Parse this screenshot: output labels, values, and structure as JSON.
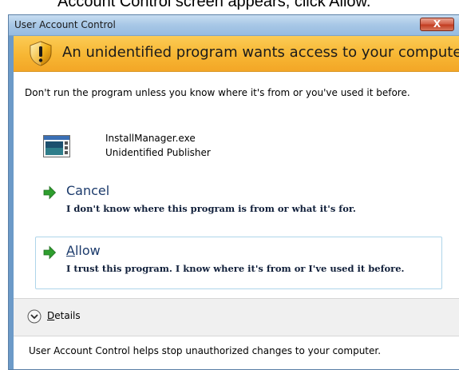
{
  "instruction": {
    "text": "Account Control screen appears, click Allow."
  },
  "window": {
    "title": "User Account Control",
    "close_label": "X"
  },
  "banner": {
    "text": "An unidentified program wants access to your computer",
    "icon": "shield-warning-icon"
  },
  "warning_text": "Don't run the program unless you know where it's from or you've used it before.",
  "program": {
    "name": "InstallManager.exe",
    "publisher": "Unidentified Publisher",
    "icon": "program-window-icon"
  },
  "options": {
    "cancel": {
      "title": "Cancel",
      "description": "I don't know where this program is from or what it's for.",
      "icon": "green-arrow-icon"
    },
    "allow": {
      "title_hotkey": "A",
      "title_rest": "llow",
      "description": "I trust this program. I know where it's from or I've used it before.",
      "icon": "green-arrow-icon"
    }
  },
  "details": {
    "hotkey": "D",
    "rest": "etails",
    "icon": "chevron-down-icon"
  },
  "footer": {
    "text": "User Account Control helps stop unauthorized changes to your computer."
  },
  "colors": {
    "banner": "#f7b633",
    "title_bar": "#a7c7e6",
    "option_border": "#aed5ea",
    "arrow_green": "#2e9e2e"
  }
}
